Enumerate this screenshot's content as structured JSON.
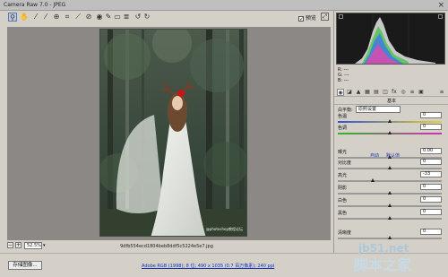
{
  "window": {
    "title": "Camera Raw 7.0 - JPEG",
    "close_glyph": "×"
  },
  "toolbar": {
    "tools": [
      "zoom-icon",
      "hand-icon",
      "white-balance-icon",
      "color-sampler-icon",
      "target-adjust-icon",
      "crop-icon",
      "straighten-icon",
      "spot-removal-icon",
      "red-eye-icon",
      "adjustment-brush-icon",
      "graduated-filter-icon",
      "preferences-icon",
      "rotate-ccw-icon",
      "rotate-cw-icon"
    ],
    "preview_label": "预览",
    "preview_checked": true
  },
  "image": {
    "filename": "9dfb554ecd1804beb8ddf5c5224e5e7.jpg",
    "watermark": "@photoshop教程论坛"
  },
  "zoom": {
    "value": "52.5%"
  },
  "bottom": {
    "save_label": "存储图像...",
    "workflow_text": "Adobe RGB (1998); 8 位; 490 x 1035 (0.7 百万像素); 240 ppi"
  },
  "panel": {
    "header": "基本",
    "white_balance_label": "白平衡:",
    "white_balance_value": "原照设置",
    "auto_label": "自动",
    "default_label": "默认值",
    "controls": [
      {
        "label": "色温",
        "value": "0",
        "pos": 0.5
      },
      {
        "label": "色调",
        "value": "0",
        "pos": 0.5
      },
      {
        "label": "曝光",
        "value": "0.00",
        "pos": 0.5
      },
      {
        "label": "对比度",
        "value": "0",
        "pos": 0.5
      },
      {
        "label": "高光",
        "value": "-33",
        "pos": 0.34
      },
      {
        "label": "阴影",
        "value": "0",
        "pos": 0.5
      },
      {
        "label": "白色",
        "value": "0",
        "pos": 0.5
      },
      {
        "label": "黑色",
        "value": "0",
        "pos": 0.5
      },
      {
        "label": "清晰度",
        "value": "0",
        "pos": 0.5
      }
    ]
  },
  "site_watermark": {
    "line1": "jb51.net",
    "line2": "脚本之家"
  }
}
